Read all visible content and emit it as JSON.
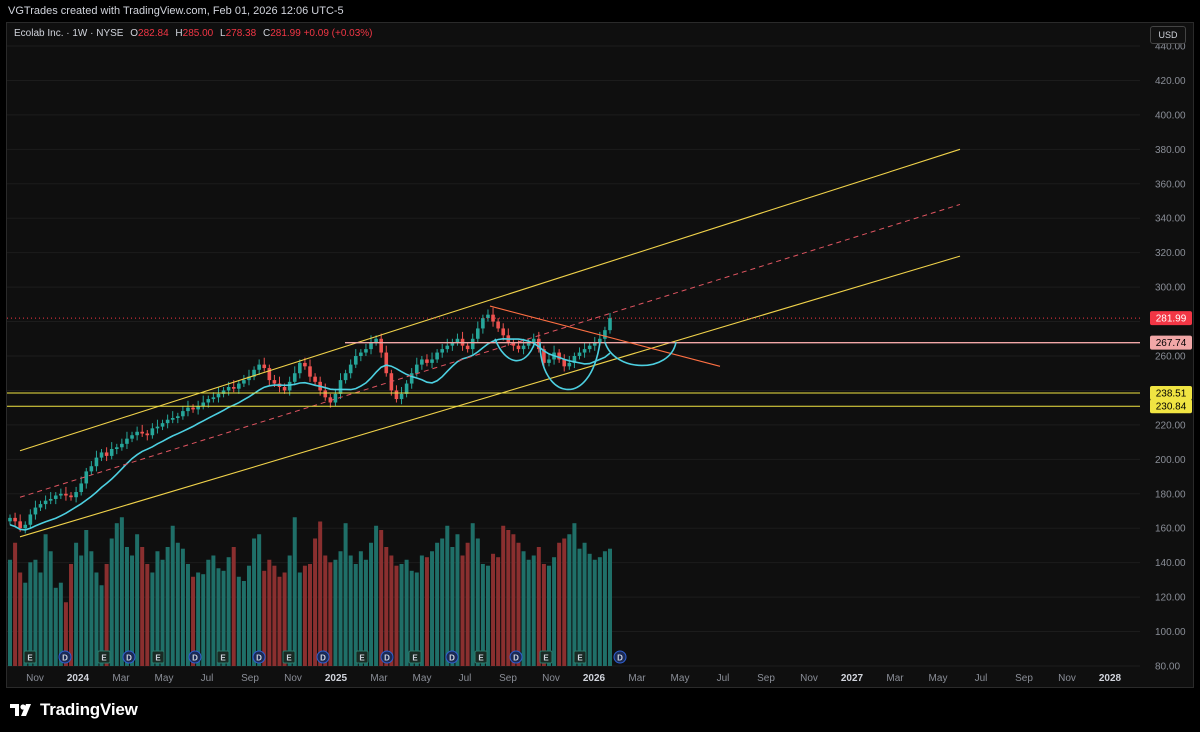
{
  "credit": "VGTrades created with TradingView.com, Feb 01, 2026 12:06 UTC-5",
  "legend": {
    "symbol": "Ecolab Inc. · 1W · NYSE",
    "o_label": "O",
    "o": "282.84",
    "h_label": "H",
    "h": "285.00",
    "l_label": "L",
    "l": "278.38",
    "c_label": "C",
    "c": "281.99",
    "change": "+0.09 (+0.03%)"
  },
  "currency": "USD",
  "logo_text": "TradingView",
  "colors": {
    "up": "#26a69a",
    "down": "#ef5350",
    "vol_up": "#1f6f68",
    "vol_down": "#8a2f2f",
    "channel": "#f0d24a",
    "ma": "#4dd0e1",
    "pattern": "#4dd0e1",
    "resistance": "#f1a7a7",
    "support": "#f0e442",
    "trend": "#ff7043",
    "last": "#f23645"
  },
  "chart_data": {
    "type": "candlestick",
    "symbol": "Ecolab Inc.",
    "interval": "1W",
    "exchange": "NYSE",
    "y_range": [
      80,
      440
    ],
    "y_ticks": [
      "440.00",
      "420.00",
      "400.00",
      "380.00",
      "360.00",
      "340.00",
      "320.00",
      "300.00",
      "280.00",
      "260.00",
      "240.00",
      "220.00",
      "200.00",
      "180.00",
      "160.00",
      "140.00",
      "120.00",
      "100.00",
      "80.00"
    ],
    "x_ticks": [
      "Nov",
      "2024",
      "Mar",
      "May",
      "Jul",
      "Sep",
      "Nov",
      "2025",
      "Mar",
      "May",
      "Jul",
      "Sep",
      "Nov",
      "2026",
      "Mar",
      "May",
      "Jul",
      "Sep",
      "Nov",
      "2027",
      "Mar",
      "May",
      "Jul",
      "Sep",
      "Nov",
      "2028"
    ],
    "price_labels": [
      {
        "text": "281.99",
        "value": 281.99,
        "color": "#f23645"
      },
      {
        "text": "267.74",
        "value": 267.74,
        "color": "#f1a7a7"
      },
      {
        "text": "238.51",
        "value": 238.51,
        "color": "#f0e442"
      },
      {
        "text": "230.84",
        "value": 230.84,
        "color": "#f0e442"
      }
    ],
    "close_series": [
      166,
      164,
      160,
      162,
      168,
      172,
      174,
      176,
      177,
      179,
      180,
      179,
      178,
      181,
      186,
      193,
      196,
      201,
      204,
      202,
      206,
      207,
      209,
      212,
      214,
      216,
      215,
      214,
      218,
      219,
      221,
      223,
      224,
      225,
      228,
      230,
      229,
      231,
      233,
      235,
      236,
      238,
      240,
      242,
      241,
      244,
      246,
      248,
      252,
      255,
      253,
      246,
      244,
      242,
      240,
      245,
      250,
      256,
      254,
      248,
      245,
      240,
      236,
      233,
      238,
      246,
      250,
      255,
      260,
      262,
      264,
      268,
      270,
      262,
      250,
      240,
      235,
      238,
      244,
      250,
      255,
      258,
      256,
      258,
      262,
      264,
      266,
      268,
      270,
      266,
      264,
      270,
      276,
      282,
      284,
      280,
      276,
      272,
      268,
      266,
      264,
      266,
      268,
      270,
      264,
      256,
      258,
      262,
      258,
      254,
      256,
      260,
      262,
      264,
      266,
      268,
      270,
      275,
      282
    ],
    "volume_series": [
      125,
      145,
      110,
      98,
      122,
      125,
      110,
      155,
      135,
      92,
      98,
      75,
      120,
      145,
      130,
      160,
      135,
      110,
      95,
      120,
      150,
      168,
      175,
      140,
      130,
      155,
      140,
      120,
      110,
      135,
      125,
      140,
      165,
      145,
      138,
      120,
      105,
      110,
      108,
      125,
      130,
      115,
      112,
      128,
      140,
      105,
      100,
      118,
      150,
      155,
      112,
      125,
      118,
      105,
      110,
      130,
      175,
      110,
      118,
      120,
      150,
      170,
      130,
      122,
      125,
      135,
      168,
      130,
      120,
      135,
      125,
      145,
      165,
      160,
      140,
      130,
      118,
      120,
      125,
      112,
      110,
      130,
      128,
      135,
      145,
      150,
      165,
      140,
      155,
      130,
      145,
      168,
      150,
      120,
      118,
      132,
      128,
      165,
      160,
      155,
      145,
      135,
      125,
      130,
      140,
      120,
      118,
      128,
      145,
      150,
      155,
      168,
      138,
      145,
      132,
      125,
      128,
      135,
      138
    ],
    "events": [
      "E",
      "D",
      "E",
      "D",
      "E",
      "D",
      "E",
      "D",
      "E",
      "D",
      "E",
      "D",
      "E",
      "D",
      "E",
      "D",
      "E",
      "E",
      "D",
      "E"
    ]
  }
}
